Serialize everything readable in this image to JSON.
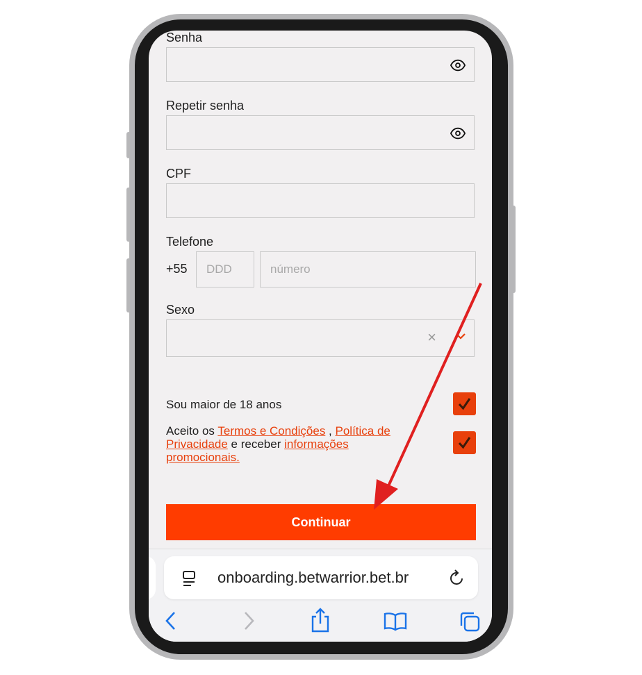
{
  "form": {
    "password": {
      "label": "Senha",
      "value": "",
      "icon": "eye-icon"
    },
    "repeat_password": {
      "label": "Repetir senha",
      "value": "",
      "icon": "eye-icon"
    },
    "cpf": {
      "label": "CPF",
      "value": ""
    },
    "phone": {
      "label": "Telefone",
      "prefix": "+55",
      "ddd_placeholder": "DDD",
      "number_placeholder": "número"
    },
    "sex": {
      "label": "Sexo",
      "value": "",
      "clear": "×"
    },
    "age_check": {
      "text": "Sou maior de 18 anos",
      "checked": true
    },
    "terms_check": {
      "text_start": "Aceito os",
      "terms_link": "Termos e Condições",
      "sep": " , ",
      "privacy_link_1": "Política de",
      "privacy_link_2": "Privacidade",
      "mid": " e receber ",
      "promo_link_1": "informações",
      "promo_link_2": "promocionais.",
      "checked": true
    },
    "submit_label": "Continuar"
  },
  "browser": {
    "url": "onboarding.betwarrior.bet.br",
    "toolbar_icons": [
      "back-icon",
      "forward-icon",
      "share-icon",
      "bookmarks-icon",
      "tabs-icon"
    ]
  },
  "colors": {
    "accent": "#ff3c00",
    "link": "#e8400c",
    "annotation_arrow": "#e02020"
  }
}
